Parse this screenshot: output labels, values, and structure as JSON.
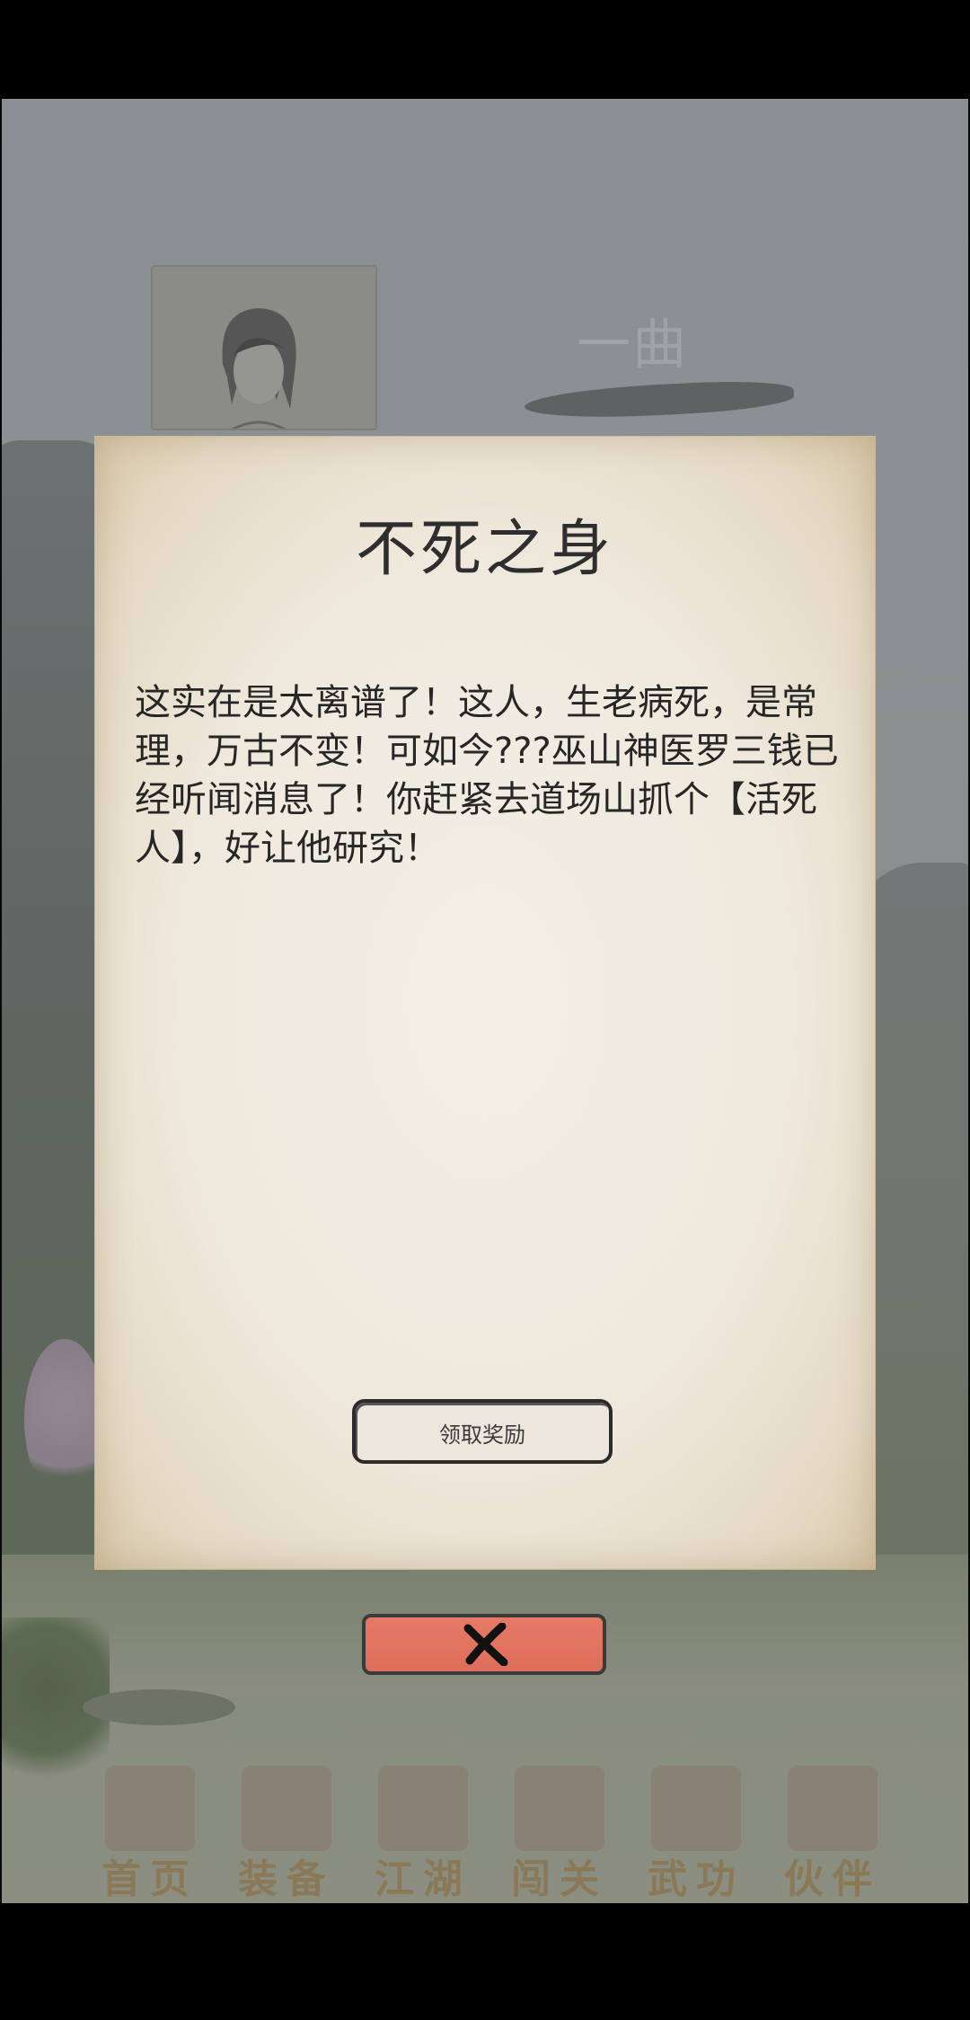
{
  "background": {
    "character_name": "一曲"
  },
  "bottom_nav": {
    "items": [
      {
        "label": "首页",
        "icon": "home-icon"
      },
      {
        "label": "装备",
        "icon": "armor-icon"
      },
      {
        "label": "江湖",
        "icon": "world-icon"
      },
      {
        "label": "闯关",
        "icon": "swords-icon"
      },
      {
        "label": "武功",
        "icon": "scroll-icon"
      },
      {
        "label": "伙伴",
        "icon": "partners-icon"
      }
    ]
  },
  "dialog": {
    "title": "不死之身",
    "body": "这实在是太离谱了！这人，生老病死，是常理，万古不变！可如今???巫山神医罗三钱已经听闻消息了！你赶紧去道场山抓个【活死人】，好让他研究！",
    "claim_button_label": "领取奖励",
    "close_icon": "close-icon"
  },
  "colors": {
    "close_button": "#e0705c",
    "paper": "#efe9dd",
    "nav_label": "#8e7b56"
  }
}
